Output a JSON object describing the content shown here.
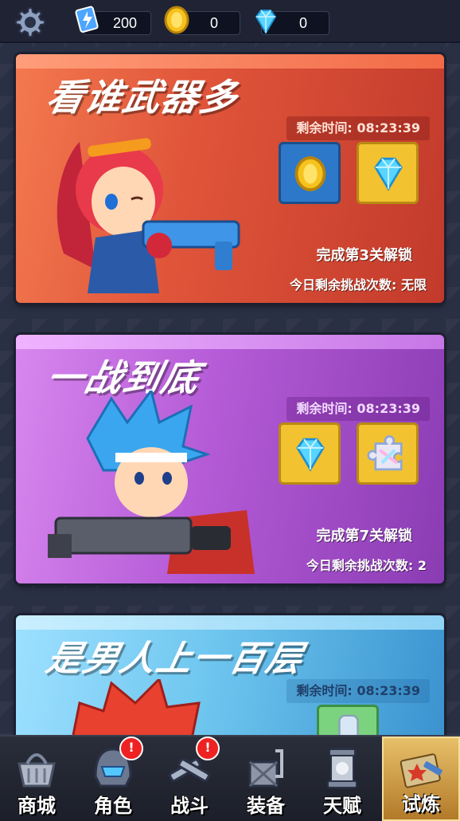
{
  "currencies": {
    "energy": "200",
    "coins": "0",
    "gems": "0"
  },
  "cards": [
    {
      "title": "看谁武器多",
      "time_label": "剩余时间:",
      "time_value": "08:23:39",
      "rewards": [
        "coin-icon",
        "gem-icon"
      ],
      "unlock_text": "完成第3关解锁",
      "tries_text": "今日剩余挑战次数: 无限"
    },
    {
      "title": "一战到底",
      "time_label": "剩余时间:",
      "time_value": "08:23:39",
      "rewards": [
        "gem-icon",
        "puzzle-icon"
      ],
      "unlock_text": "完成第7关解锁",
      "tries_text": "今日剩余挑战次数: 2"
    },
    {
      "title": "是男人上一百层",
      "time_label": "剩余时间:",
      "time_value": "08:23:39",
      "rewards": [
        "potion-icon"
      ]
    }
  ],
  "nav": [
    {
      "label": "商城",
      "icon": "basket-icon",
      "badge": ""
    },
    {
      "label": "角色",
      "icon": "helmet-icon",
      "badge": "!"
    },
    {
      "label": "战斗",
      "icon": "crossed-guns-icon",
      "badge": "!"
    },
    {
      "label": "装备",
      "icon": "crate-icon",
      "badge": ""
    },
    {
      "label": "天赋",
      "icon": "talent-icon",
      "badge": ""
    },
    {
      "label": "试炼",
      "icon": "trial-icon",
      "badge": "",
      "active": true
    }
  ],
  "colors": {
    "card1": "#e0553a",
    "card2": "#b45ad6",
    "card3": "#6ec6ef",
    "accent_gold": "#f2c230"
  }
}
